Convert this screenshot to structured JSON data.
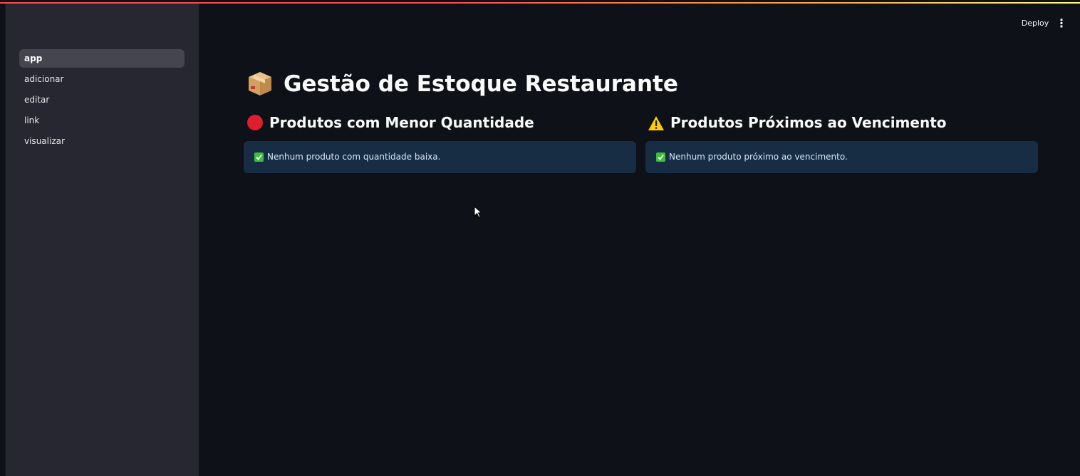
{
  "sidebar": {
    "items": [
      {
        "label": "app",
        "active": true
      },
      {
        "label": "adicionar",
        "active": false
      },
      {
        "label": "editar",
        "active": false
      },
      {
        "label": "link",
        "active": false
      },
      {
        "label": "visualizar",
        "active": false
      }
    ]
  },
  "header": {
    "deploy_label": "Deploy",
    "menu_icon": "vertical-ellipsis-icon",
    "menu_glyph": "⋮"
  },
  "main": {
    "title": "Gestão de Estoque Restaurante",
    "title_icon": "package-box-icon",
    "columns": [
      {
        "subheader": "Produtos com Menor Quantidade",
        "icon": "red-circle-icon",
        "alert_icon": "check-mark-icon",
        "alert_text": "Nenhum produto com quantidade baixa."
      },
      {
        "subheader": "Produtos Próximos ao Vencimento",
        "icon": "warning-icon",
        "alert_icon": "check-mark-icon",
        "alert_text": "Nenhum produto próximo ao vencimento."
      }
    ]
  },
  "colors": {
    "background": "#0e1117",
    "sidebar": "#262730",
    "sidebar_active": "#44454f",
    "alert_background": "#172d43",
    "accent_red": "#ff4b4b",
    "check_green": "#3dbe3d",
    "warning_yellow": "#ffcc00"
  }
}
